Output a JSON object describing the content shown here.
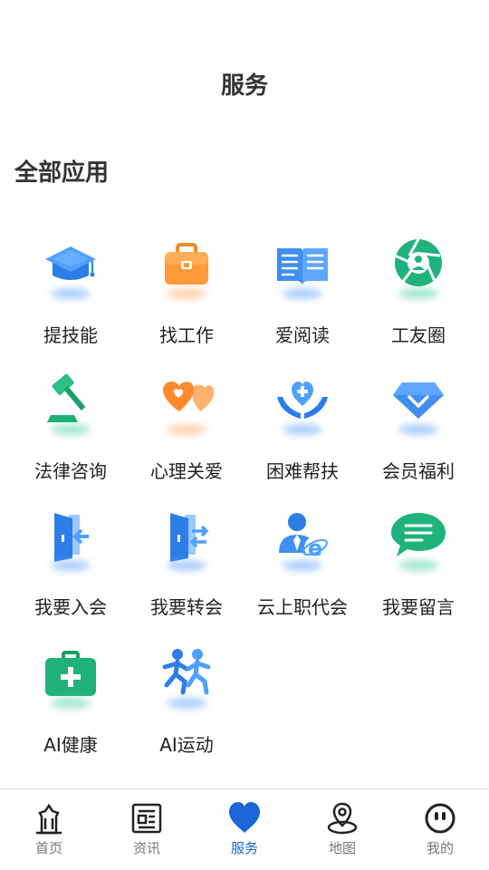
{
  "header": {
    "title": "服务"
  },
  "section": {
    "title": "全部应用"
  },
  "apps": [
    {
      "label": "提技能",
      "icon": "graduation-cap-icon"
    },
    {
      "label": "找工作",
      "icon": "briefcase-icon"
    },
    {
      "label": "爱阅读",
      "icon": "open-book-icon"
    },
    {
      "label": "工友圈",
      "icon": "camera-aperture-icon"
    },
    {
      "label": "法律咨询",
      "icon": "gavel-icon"
    },
    {
      "label": "心理关爱",
      "icon": "hearts-icon"
    },
    {
      "label": "困难帮扶",
      "icon": "hands-heart-icon"
    },
    {
      "label": "会员福利",
      "icon": "diamond-icon"
    },
    {
      "label": "我要入会",
      "icon": "door-enter-icon"
    },
    {
      "label": "我要转会",
      "icon": "door-transfer-icon"
    },
    {
      "label": "云上职代会",
      "icon": "user-browser-icon"
    },
    {
      "label": "我要留言",
      "icon": "chat-bubble-icon"
    },
    {
      "label": "AI健康",
      "icon": "medical-kit-icon"
    },
    {
      "label": "AI运动",
      "icon": "running-people-icon"
    }
  ],
  "tabbar": {
    "items": [
      {
        "label": "首页",
        "icon": "home-tower-icon"
      },
      {
        "label": "资讯",
        "icon": "news-icon"
      },
      {
        "label": "服务",
        "icon": "heart-icon"
      },
      {
        "label": "地图",
        "icon": "map-pin-icon"
      },
      {
        "label": "我的",
        "icon": "face-icon"
      }
    ],
    "active": "服务"
  },
  "colors": {
    "accent": "#1a66d9",
    "inactive": "#777777"
  }
}
